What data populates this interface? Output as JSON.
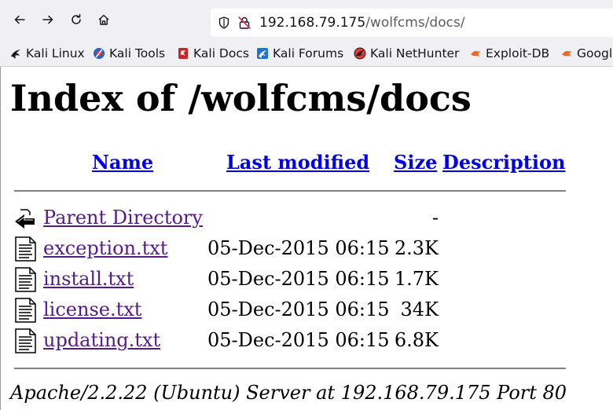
{
  "browser": {
    "url_host": "192.168.79.175",
    "url_path": "/wolfcms/docs/",
    "bookmarks": [
      {
        "label": "Kali Linux",
        "icon": "kali-dragon-icon"
      },
      {
        "label": "Kali Tools",
        "icon": "kali-tools-icon"
      },
      {
        "label": "Kali Docs",
        "icon": "kali-docs-icon"
      },
      {
        "label": "Kali Forums",
        "icon": "kali-forums-icon"
      },
      {
        "label": "Kali NetHunter",
        "icon": "kali-nethunter-icon"
      },
      {
        "label": "Exploit-DB",
        "icon": "exploit-db-icon"
      },
      {
        "label": "Googl",
        "icon": "google-hacking-db-icon"
      }
    ]
  },
  "page": {
    "title": "Index of /wolfcms/docs",
    "columns": {
      "name": "Name",
      "last_modified": "Last modified",
      "size": "Size",
      "description": "Description"
    },
    "rows": [
      {
        "name": "Parent Directory",
        "date": "",
        "size": "-",
        "icon": "back-arrow-icon"
      },
      {
        "name": "exception.txt",
        "date": "05-Dec-2015 06:15",
        "size": "2.3K",
        "icon": "text-file-icon"
      },
      {
        "name": "install.txt",
        "date": "05-Dec-2015 06:15",
        "size": "1.7K",
        "icon": "text-file-icon"
      },
      {
        "name": "license.txt",
        "date": "05-Dec-2015 06:15",
        "size": "34K",
        "icon": "text-file-icon"
      },
      {
        "name": "updating.txt",
        "date": "05-Dec-2015 06:15",
        "size": "6.8K",
        "icon": "text-file-icon"
      }
    ],
    "footer": "Apache/2.2.22 (Ubuntu) Server at 192.168.79.175 Port 80"
  }
}
